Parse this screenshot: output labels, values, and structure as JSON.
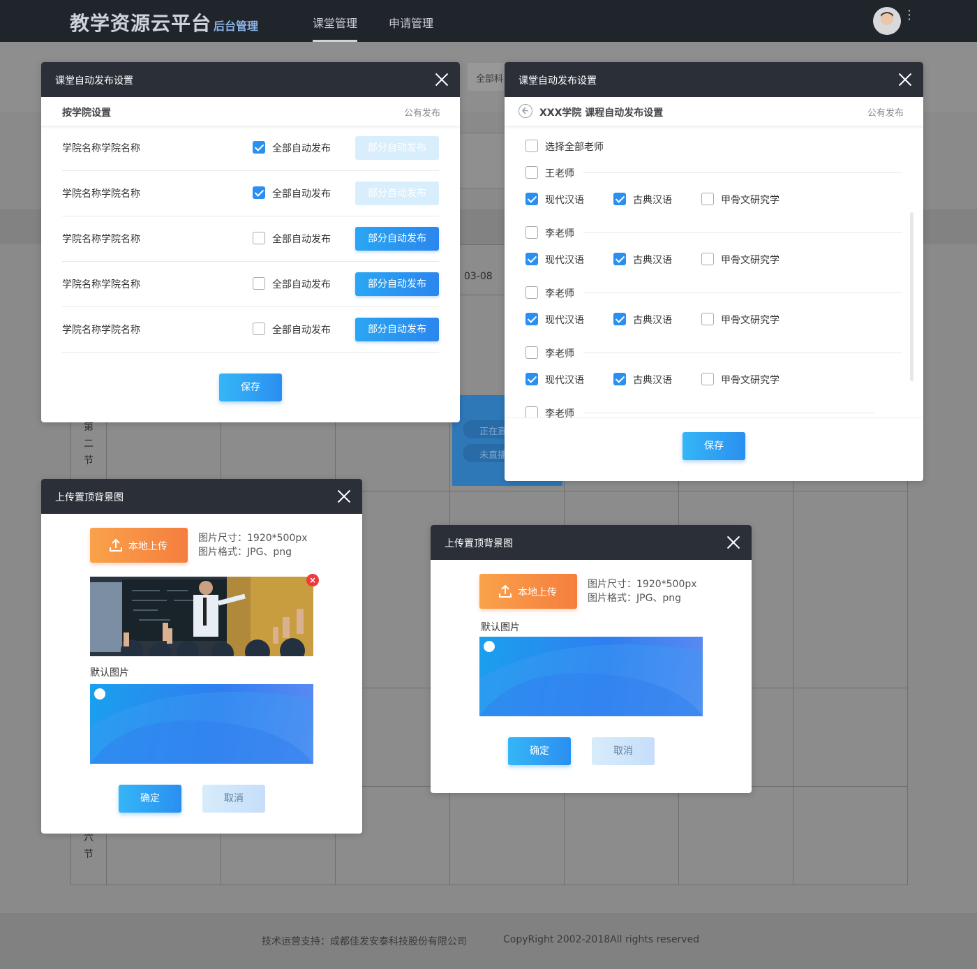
{
  "app": {
    "brand": "教学资源云平台",
    "brand_sub": "后台管理",
    "nav": [
      "课堂管理",
      "申请管理"
    ],
    "kebab": "⋮"
  },
  "backdrop": {
    "filter_chip": "全部科目",
    "date": "03-08",
    "section_2": [
      "第",
      "二",
      "节"
    ],
    "section_6": [
      "六",
      "节"
    ],
    "pill_live": "正在直播",
    "pill_notlive": "未直播"
  },
  "footer": {
    "support": "技术运营支持：成都佳发安泰科技股份有限公司",
    "copyright": "CopyRight 2002-2018All rights reserved"
  },
  "modal_college": {
    "title": "课堂自动发布设置",
    "subtitle": "按学院设置",
    "public_label": "公有发布",
    "rows": [
      {
        "name": "学院名称学院名称",
        "all_label": "全部自动发布",
        "all_checked": true,
        "part_label": "部分自动发布",
        "part_enabled": false
      },
      {
        "name": "学院名称学院名称",
        "all_label": "全部自动发布",
        "all_checked": true,
        "part_label": "部分自动发布",
        "part_enabled": false
      },
      {
        "name": "学院名称学院名称",
        "all_label": "全部自动发布",
        "all_checked": false,
        "part_label": "部分自动发布",
        "part_enabled": true
      },
      {
        "name": "学院名称学院名称",
        "all_label": "全部自动发布",
        "all_checked": false,
        "part_label": "部分自动发布",
        "part_enabled": true
      },
      {
        "name": "学院名称学院名称",
        "all_label": "全部自动发布",
        "all_checked": false,
        "part_label": "部分自动发布",
        "part_enabled": true
      }
    ],
    "save": "保存"
  },
  "modal_teacher": {
    "title": "课堂自动发布设置",
    "subtitle": "XXX学院 课程自动发布设置",
    "public_label": "公有发布",
    "select_all": "选择全部老师",
    "teachers": [
      {
        "name": "王老师",
        "courses": [
          {
            "name": "现代汉语",
            "checked": true
          },
          {
            "name": "古典汉语",
            "checked": true
          },
          {
            "name": "甲骨文研究学",
            "checked": false
          }
        ]
      },
      {
        "name": "李老师",
        "courses": [
          {
            "name": "现代汉语",
            "checked": true
          },
          {
            "name": "古典汉语",
            "checked": true
          },
          {
            "name": "甲骨文研究学",
            "checked": false
          }
        ]
      },
      {
        "name": "李老师",
        "courses": [
          {
            "name": "现代汉语",
            "checked": true
          },
          {
            "name": "古典汉语",
            "checked": true
          },
          {
            "name": "甲骨文研究学",
            "checked": false
          }
        ]
      },
      {
        "name": "李老师",
        "courses": [
          {
            "name": "现代汉语",
            "checked": true
          },
          {
            "name": "古典汉语",
            "checked": true
          },
          {
            "name": "甲骨文研究学",
            "checked": false
          }
        ]
      },
      {
        "name": "李老师",
        "courses": []
      }
    ],
    "save": "保存"
  },
  "modal_upload_a": {
    "title": "上传置顶背景图",
    "upload": "本地上传",
    "size": "图片尺寸：1920*500px",
    "format": "图片格式：JPG、png",
    "default_label": "默认图片",
    "ok": "确定",
    "cancel": "取消"
  },
  "modal_upload_b": {
    "title": "上传置顶背景图",
    "upload": "本地上传",
    "size": "图片尺寸：1920*500px",
    "format": "图片格式：JPG、png",
    "default_label": "默认图片",
    "ok": "确定",
    "cancel": "取消"
  },
  "colors": {
    "accent": "#2a8ff0",
    "header": "#2b3038",
    "upload": "#f57e3f",
    "close_badge": "#f03a3a"
  }
}
